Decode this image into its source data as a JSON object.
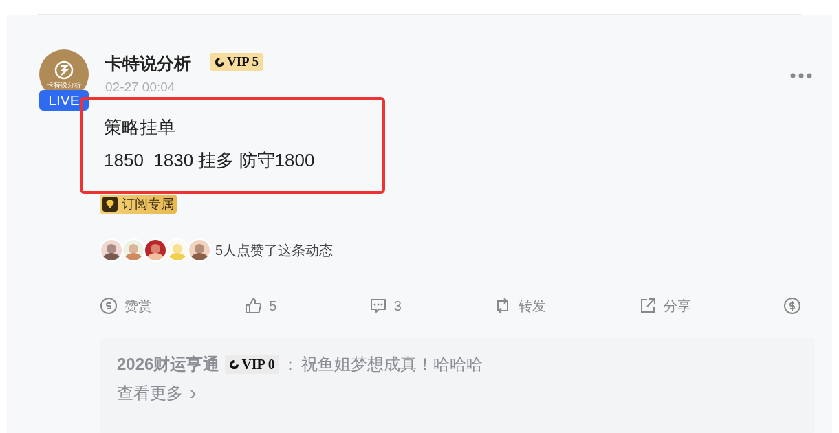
{
  "post": {
    "author": "卡特说分析",
    "avatar_caption": "卡特说分析",
    "live_badge": "LIVE",
    "vip_badge": "VIP 5",
    "time": "02-27 00:04",
    "content_lines": [
      "策略挂单",
      "1850  1830 挂多 防守1800"
    ],
    "highlighted": true,
    "tag": "订阅专属",
    "likes_text": "5人点赞了这条动态",
    "actions": [
      {
        "kind": "reward",
        "label": "赞赏"
      },
      {
        "kind": "like",
        "label": "5"
      },
      {
        "kind": "comment",
        "label": "3"
      },
      {
        "kind": "repost",
        "label": "转发"
      },
      {
        "kind": "share",
        "label": "分享"
      },
      {
        "kind": "tip"
      }
    ],
    "comments": [
      {
        "user": "2026财运亨通",
        "vip_badge": "VIP 0",
        "separator": "：",
        "text": "祝鱼姐梦想成真！哈哈哈"
      }
    ],
    "more_comments": "查看更多",
    "more_chevron": "›"
  }
}
